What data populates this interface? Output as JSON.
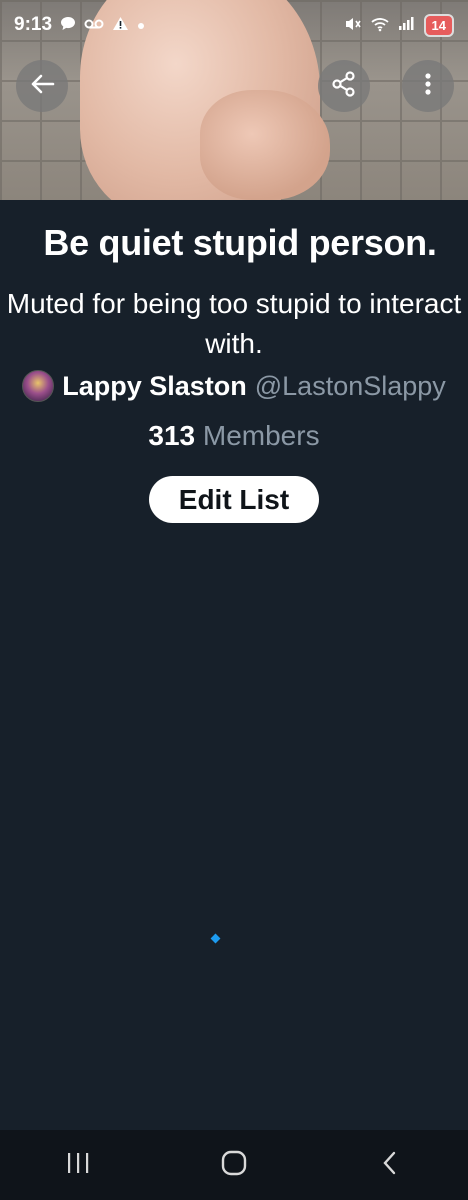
{
  "status_bar": {
    "time": "9:13",
    "battery": "14"
  },
  "header": {
    "back_icon": "arrow-left-icon",
    "share_icon": "share-icon",
    "more_icon": "more-vertical-icon"
  },
  "list": {
    "title": "Be quiet stupid person.",
    "description": "Muted for being too stupid to interact with.",
    "owner_name": "Lappy Slaston",
    "owner_handle": "@LastonSlappy",
    "member_count": "313",
    "member_label": "Members",
    "edit_label": "Edit List"
  },
  "colors": {
    "background": "#17202a",
    "secondary_text": "#8b98a5",
    "accent": "#1d9bf0"
  },
  "nav": {
    "recents_icon": "recents-icon",
    "home_icon": "home-icon",
    "back_icon": "nav-back-icon"
  }
}
